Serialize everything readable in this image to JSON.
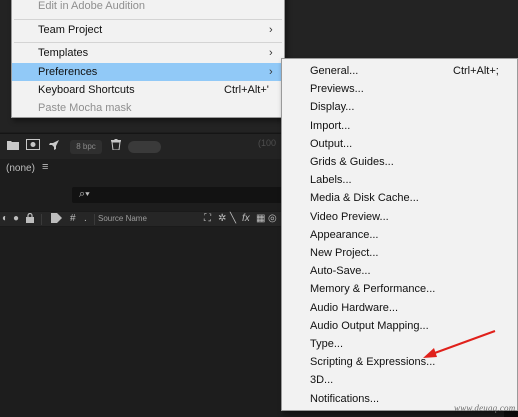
{
  "parent_menu": {
    "items": [
      {
        "label": "Edit in Adobe Audition",
        "disabled": true,
        "arrow": false,
        "shortcut": ""
      },
      {
        "label": "Team Project",
        "disabled": false,
        "arrow": true,
        "shortcut": ""
      },
      {
        "label": "Templates",
        "disabled": false,
        "arrow": true,
        "shortcut": ""
      },
      {
        "label": "Preferences",
        "disabled": false,
        "arrow": true,
        "shortcut": "",
        "highlighted": true
      },
      {
        "label": "Keyboard Shortcuts",
        "disabled": false,
        "arrow": false,
        "shortcut": "Ctrl+Alt+'"
      },
      {
        "label": "Paste Mocha mask",
        "disabled": true,
        "arrow": false,
        "shortcut": ""
      }
    ],
    "highlight_color": "#91c9f7"
  },
  "preferences_submenu": {
    "items": [
      {
        "label": "General...",
        "shortcut": "Ctrl+Alt+;"
      },
      {
        "label": "Previews...",
        "shortcut": ""
      },
      {
        "label": "Display...",
        "shortcut": ""
      },
      {
        "label": "Import...",
        "shortcut": ""
      },
      {
        "label": "Output...",
        "shortcut": ""
      },
      {
        "label": "Grids & Guides...",
        "shortcut": ""
      },
      {
        "label": "Labels...",
        "shortcut": ""
      },
      {
        "label": "Media & Disk Cache...",
        "shortcut": ""
      },
      {
        "label": "Video Preview...",
        "shortcut": ""
      },
      {
        "label": "Appearance...",
        "shortcut": ""
      },
      {
        "label": "New Project...",
        "shortcut": ""
      },
      {
        "label": "Auto-Save...",
        "shortcut": ""
      },
      {
        "label": "Memory & Performance...",
        "shortcut": ""
      },
      {
        "label": "Audio Hardware...",
        "shortcut": ""
      },
      {
        "label": "Audio Output Mapping...",
        "shortcut": ""
      },
      {
        "label": "Type...",
        "shortcut": ""
      },
      {
        "label": "Scripting & Expressions...",
        "shortcut": ""
      },
      {
        "label": "3D...",
        "shortcut": ""
      },
      {
        "label": "Notifications...",
        "shortcut": ""
      }
    ],
    "annotated_item": "Scripting & Expressions..."
  },
  "project_panel": {
    "bpc_label": "8 bpc",
    "ghost_label": "(100",
    "comp_none": "(none)",
    "comp_menu_icon": "hamburger-icon",
    "search_icon": "search-icon",
    "source_name_header": "Source Name"
  },
  "annotation": {
    "arrow_color": "#e0211b"
  },
  "watermark": "www.deuaq.com"
}
